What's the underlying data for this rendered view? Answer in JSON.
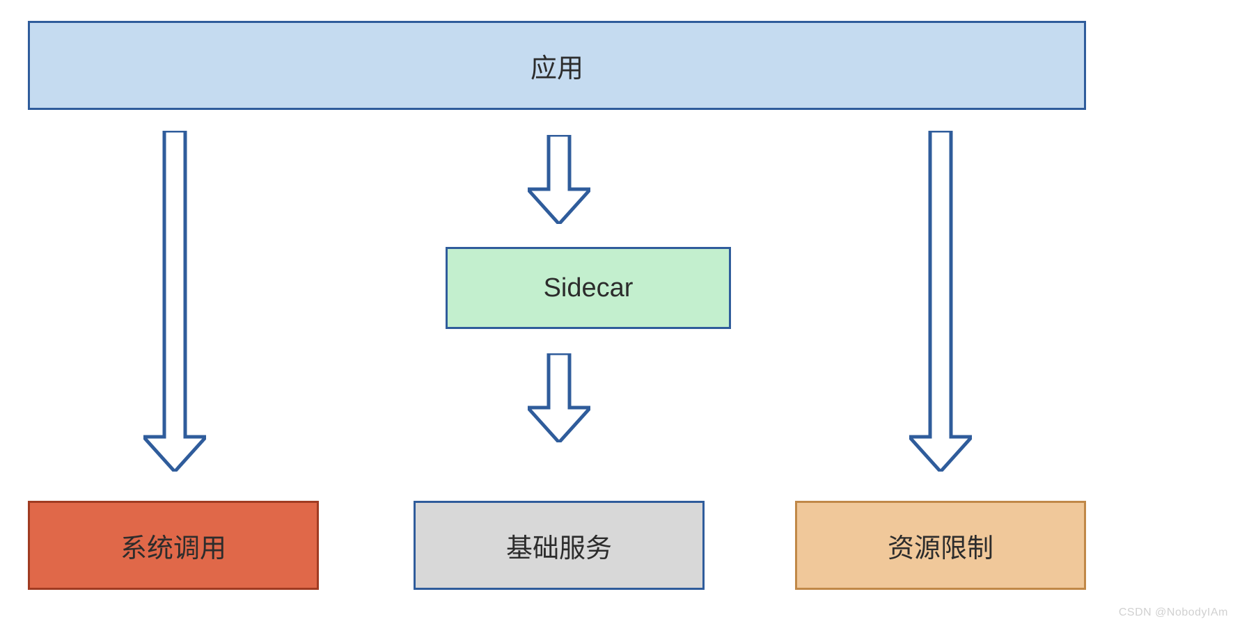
{
  "boxes": {
    "application": {
      "label": "应用",
      "bg": "#c5dbf0",
      "border": "#2f5c9b"
    },
    "sidecar": {
      "label": "Sidecar",
      "bg": "#c3efce",
      "border": "#2f5c9b"
    },
    "system_call": {
      "label": "系统调用",
      "bg": "#e06849",
      "border": "#a03b22"
    },
    "base_service": {
      "label": "基础服务",
      "bg": "#d8d8d8",
      "border": "#2f5c9b"
    },
    "resource_limit": {
      "label": "资源限制",
      "bg": "#f0c89a",
      "border": "#c08848"
    }
  },
  "arrow": {
    "fill": "#ffffff",
    "stroke": "#2f5c9b"
  },
  "watermark": "CSDN @NobodyIAm"
}
